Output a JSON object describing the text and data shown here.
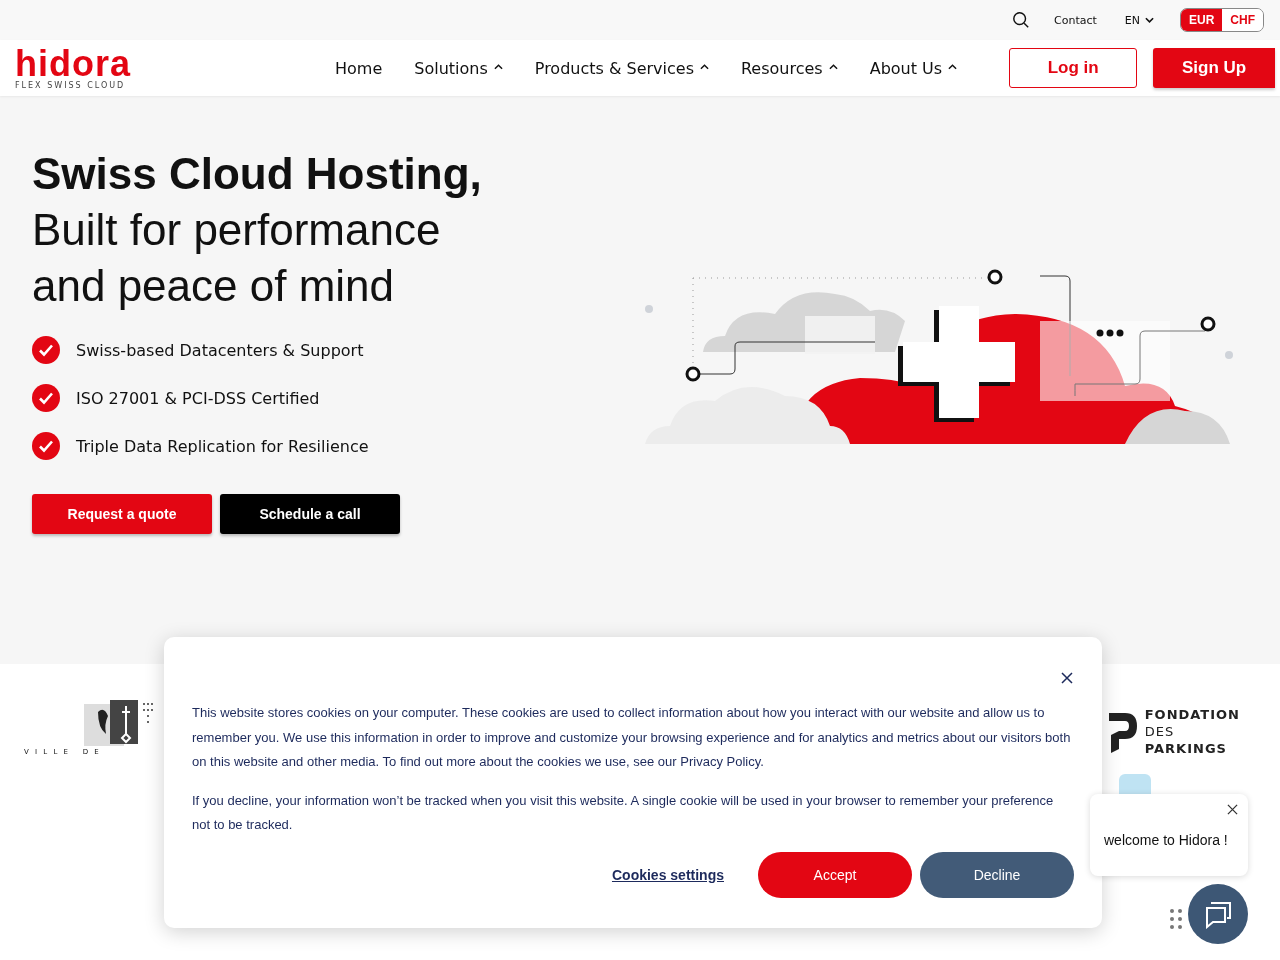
{
  "topbar": {
    "contact": "Contact",
    "language": "EN",
    "currencies": [
      {
        "label": "EUR",
        "selected": true
      },
      {
        "label": "CHF",
        "selected": false
      }
    ]
  },
  "logo": {
    "name": "hidora",
    "tagline": "FLEX SWISS CLOUD"
  },
  "nav": [
    {
      "label": "Home",
      "dropdown": false
    },
    {
      "label": "Solutions",
      "dropdown": true
    },
    {
      "label": "Products & Services",
      "dropdown": true
    },
    {
      "label": "Resources",
      "dropdown": true
    },
    {
      "label": "About Us",
      "dropdown": true
    }
  ],
  "auth": {
    "login": "Log in",
    "signup": "Sign Up"
  },
  "hero": {
    "title": "Swiss Cloud Hosting,",
    "subtitle_lines": [
      "Built for performance",
      "and peace of mind"
    ],
    "features": [
      "Swiss-based Datacenters & Support",
      "ISO 27001 & PCI-DSS Certified",
      "Triple Data Replication for Resilience"
    ],
    "buttons": [
      {
        "label": "Request a quote",
        "kind": "primary"
      },
      {
        "label": "Schedule a call",
        "kind": "dark"
      }
    ]
  },
  "clients": {
    "left": {
      "caption": "V I L L E   D E"
    },
    "right": {
      "lines": [
        "FONDATION",
        "DES",
        "PARKINGS"
      ]
    }
  },
  "cookie_banner": {
    "paragraphs": [
      "This website stores cookies on your computer. These cookies are used to collect information about how you interact with our website and allow us to remember you. We use this information in order to improve and customize your browsing experience and for analytics and metrics about our visitors both on this website and other media. To find out more about the cookies we use, see our Privacy Policy.",
      "If you decline, your information won’t be tracked when you visit this website. A single cookie will be used in your browser to remember your preference not to be tracked."
    ],
    "settings_link": "Cookies settings",
    "accept": "Accept",
    "decline": "Decline"
  },
  "chat": {
    "message": "welcome to Hidora !"
  }
}
